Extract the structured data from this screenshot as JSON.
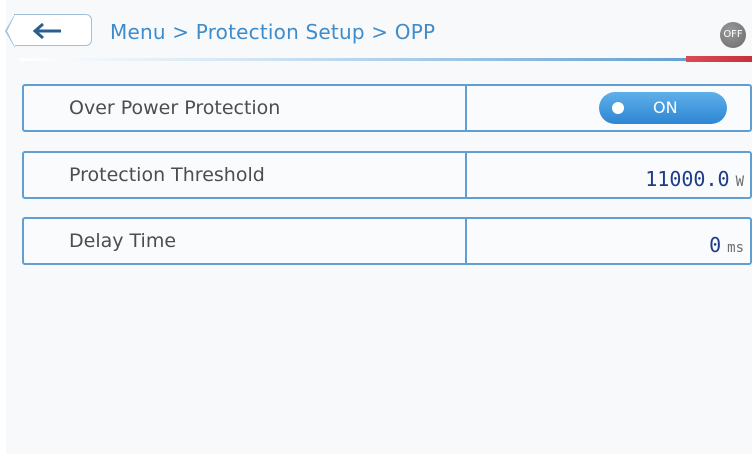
{
  "header": {
    "breadcrumb": "Menu > Protection Setup > OPP",
    "power_badge": "OFF"
  },
  "settings": [
    {
      "label": "Over Power Protection",
      "toggle_text": "ON",
      "toggle_state": "on"
    },
    {
      "label": "Protection Threshold",
      "value": "11000.0",
      "unit": "W"
    },
    {
      "label": "Delay Time",
      "value": "0",
      "unit": "ms"
    }
  ],
  "colors": {
    "accent": "#3f8ccb",
    "border": "#5f9fd3",
    "toggle_on": "#2e86d3",
    "value_text": "#1f3c8a",
    "header_accent": "#d94c55"
  }
}
